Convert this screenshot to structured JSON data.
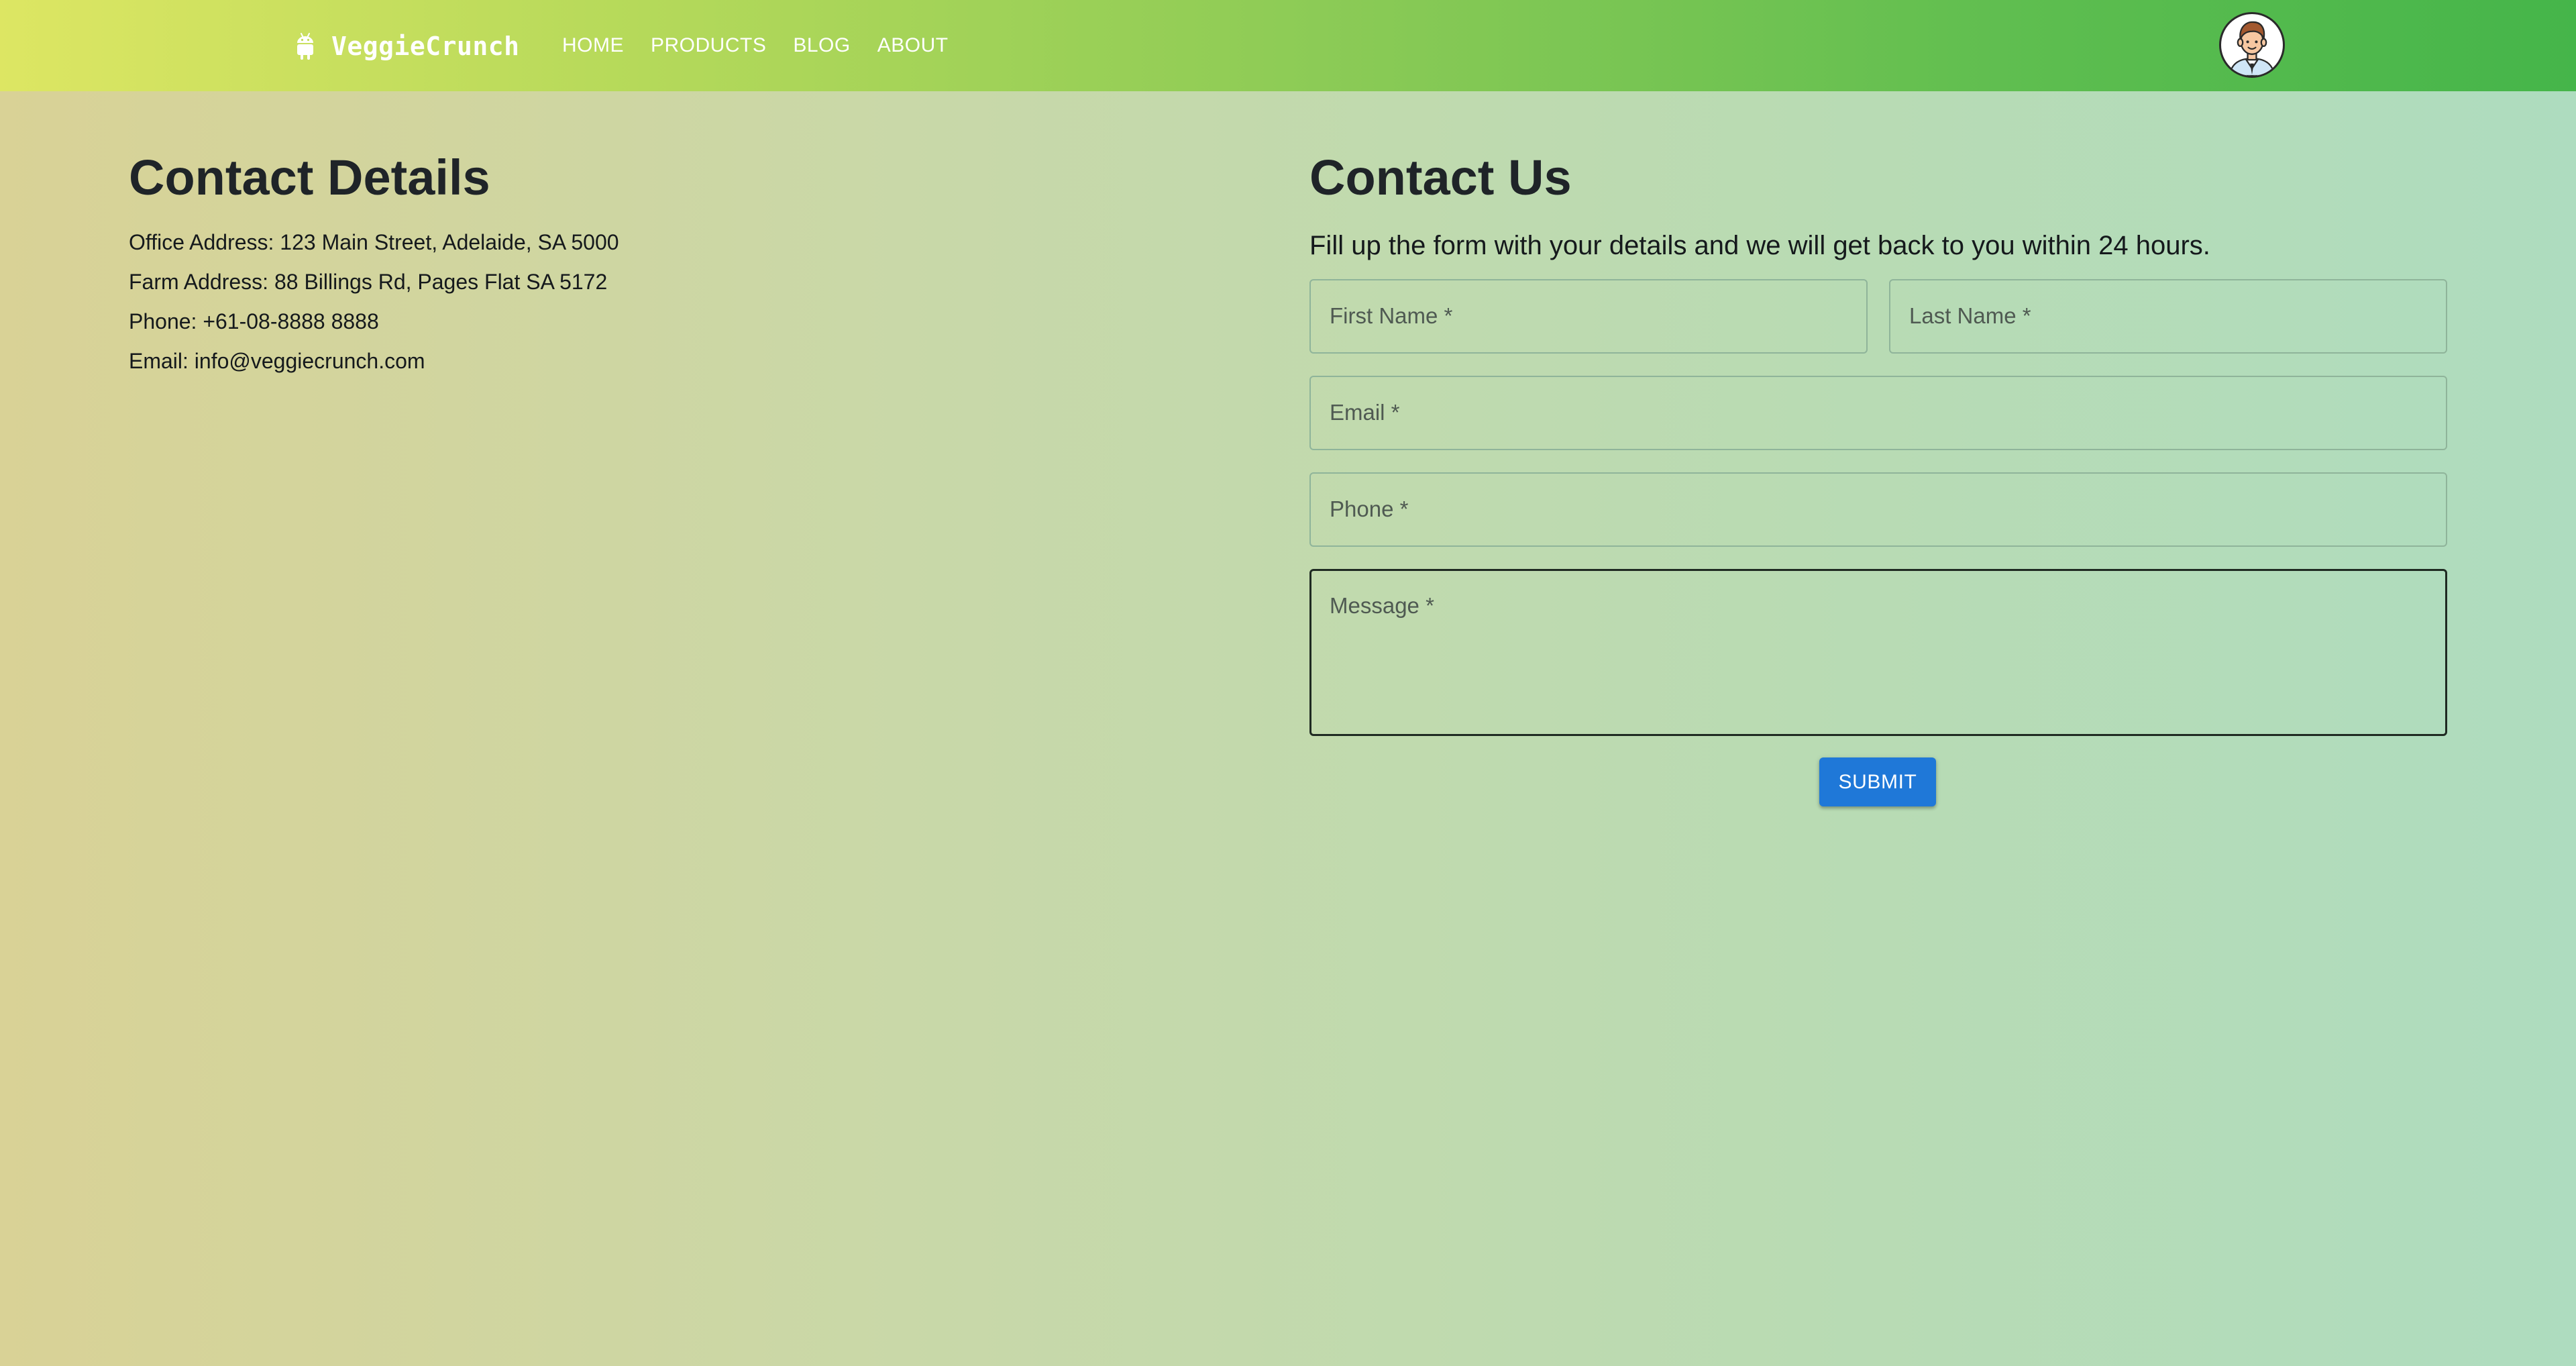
{
  "header": {
    "brand": {
      "name": "VeggieCrunch",
      "icon": "android-robot-icon"
    },
    "nav": [
      {
        "label": "HOME"
      },
      {
        "label": "PRODUCTS"
      },
      {
        "label": "BLOG"
      },
      {
        "label": "ABOUT"
      }
    ],
    "avatar": {
      "icon": "user-avatar-icon"
    }
  },
  "contact_details": {
    "title": "Contact Details",
    "lines": [
      "Office Address: 123 Main Street, Adelaide, SA 5000",
      "Farm Address: 88 Billings Rd, Pages Flat SA 5172",
      "Phone: +61-08-8888 8888",
      "Email: info@veggiecrunch.com"
    ]
  },
  "contact_form": {
    "title": "Contact Us",
    "subtitle": "Fill up the form with your details and we will get back to you within 24 hours.",
    "fields": {
      "first_name": {
        "label": "First Name *",
        "value": ""
      },
      "last_name": {
        "label": "Last Name *",
        "value": ""
      },
      "email": {
        "label": "Email *",
        "value": ""
      },
      "phone": {
        "label": "Phone *",
        "value": ""
      },
      "message": {
        "label": "Message *",
        "value": ""
      }
    },
    "submit_label": "SUBMIT"
  },
  "colors": {
    "navbar_start": "#dde663",
    "navbar_end": "#45b54a",
    "background_start": "#d9d296",
    "background_end": "#aedcbf",
    "primary_button": "#1f78d8",
    "text_dark": "#1f2428",
    "field_border": "#8fb49a"
  }
}
